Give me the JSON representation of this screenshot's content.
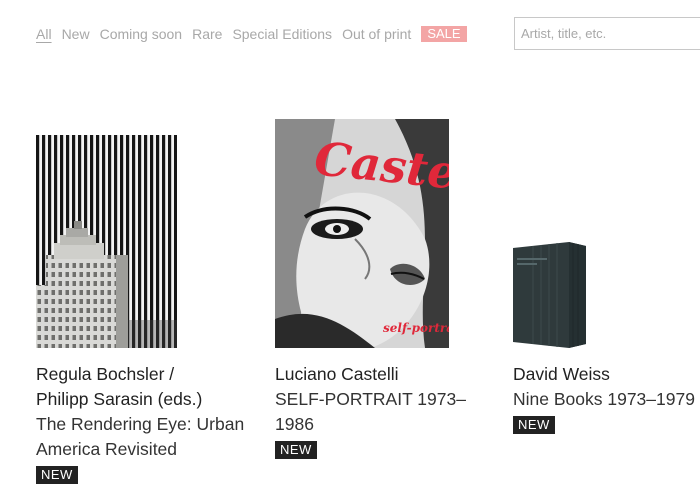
{
  "filters": [
    {
      "label": "All"
    },
    {
      "label": "New"
    },
    {
      "label": "Coming soon"
    },
    {
      "label": "Rare"
    },
    {
      "label": "Special Editions"
    },
    {
      "label": "Out of print"
    },
    {
      "label": "SALE"
    }
  ],
  "search": {
    "placeholder": "Artist, title, etc."
  },
  "products": [
    {
      "author_lines": [
        "Regula Bochsler /",
        "Philipp Sarasin (eds.)"
      ],
      "title_lines": [
        "The Rendering Eye: Urban",
        "America Revisited"
      ],
      "badge": "NEW"
    },
    {
      "author_lines": [
        "Luciano Castelli"
      ],
      "title_lines": [
        "SELF-PORTRAIT 1973–",
        "1986"
      ],
      "badge": "NEW",
      "cover_title": "Castelli",
      "cover_subtitle": "self-portrait"
    },
    {
      "author_lines": [
        "David Weiss"
      ],
      "title_lines": [
        "Nine Books 1973–1979"
      ],
      "badge": "NEW"
    }
  ],
  "colors": {
    "sale": "#f3a5a5",
    "badge": "#222222",
    "castelli_red": "#e0283a",
    "box": "#2f3a3c"
  }
}
